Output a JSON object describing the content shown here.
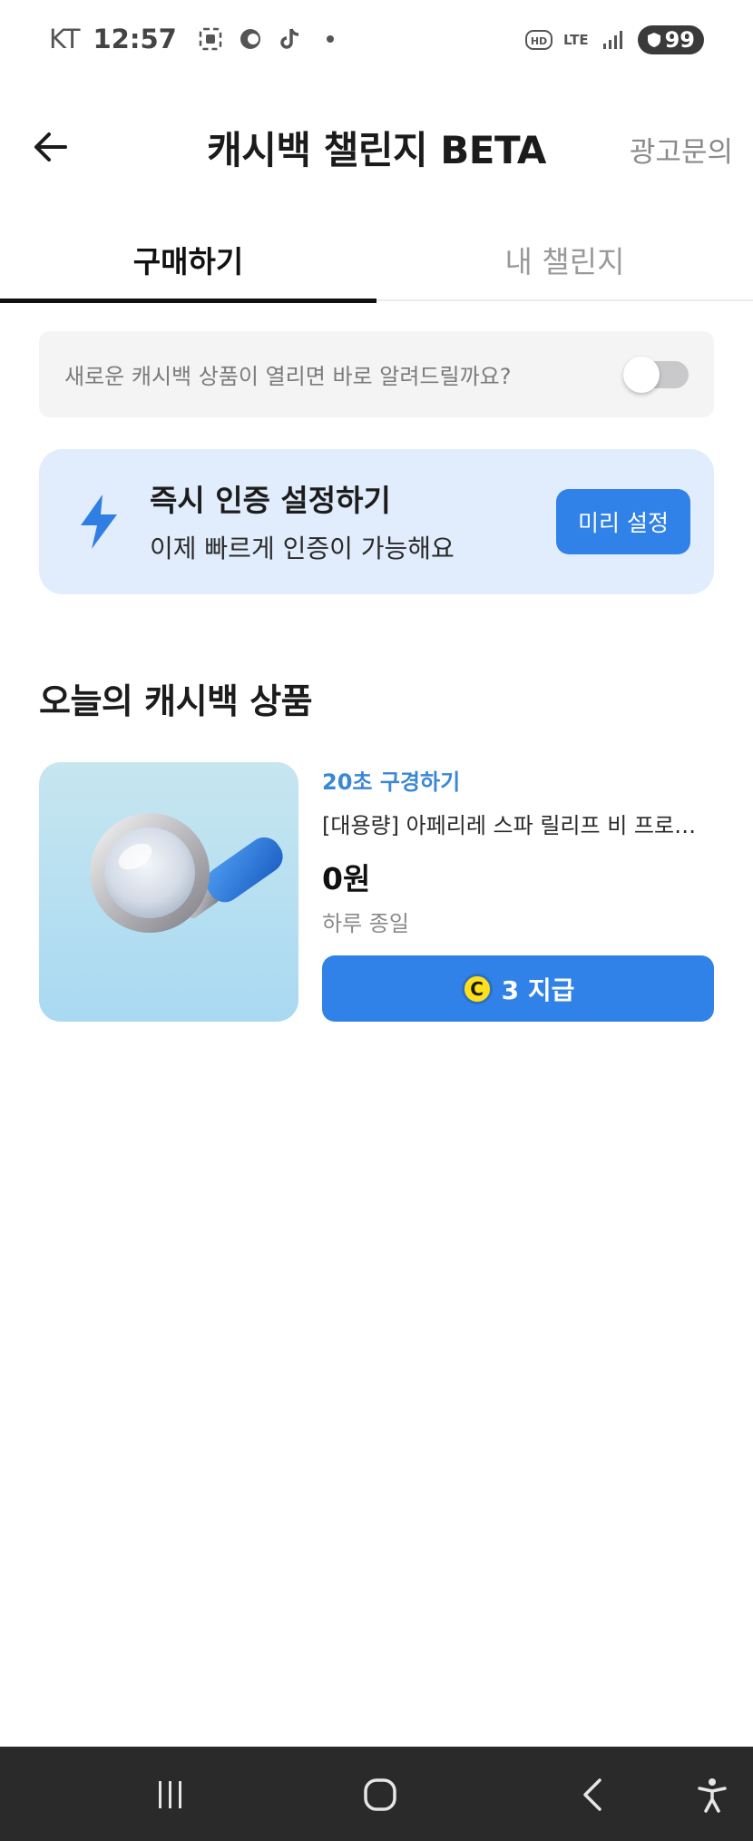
{
  "status_bar": {
    "carrier": "KT",
    "time": "12:57",
    "network": "LTE",
    "battery": "99"
  },
  "header": {
    "title": "캐시백 챌린지 BETA",
    "ad_link": "광고문의",
    "back_icon": "arrow-left-icon"
  },
  "tabs": [
    {
      "label": "구매하기",
      "active": true
    },
    {
      "label": "내 챌린지",
      "active": false
    }
  ],
  "notify": {
    "text": "새로운 캐시백 상품이 열리면 바로 알려드릴까요?",
    "toggle_on": false
  },
  "auth_card": {
    "title": "즉시 인증 설정하기",
    "subtitle": "이제 빠르게 인증이 가능해요",
    "button_label": "미리 설정",
    "icon": "lightning-bolt-icon",
    "accent_color": "#3182e8"
  },
  "section": {
    "title": "오늘의 캐시백 상품"
  },
  "product": {
    "tag": "20초 구경하기",
    "name": "[대용량] 아페리레 스파 릴리프 비 프로…",
    "price": "0원",
    "period": "하루 종일",
    "thumbnail_icon": "magnifying-glass-icon",
    "reward": {
      "coin_symbol": "C",
      "label": "3 지급"
    }
  },
  "navbar": {
    "icons": [
      "recent-apps-icon",
      "home-icon",
      "back-icon",
      "accessibility-icon"
    ]
  }
}
